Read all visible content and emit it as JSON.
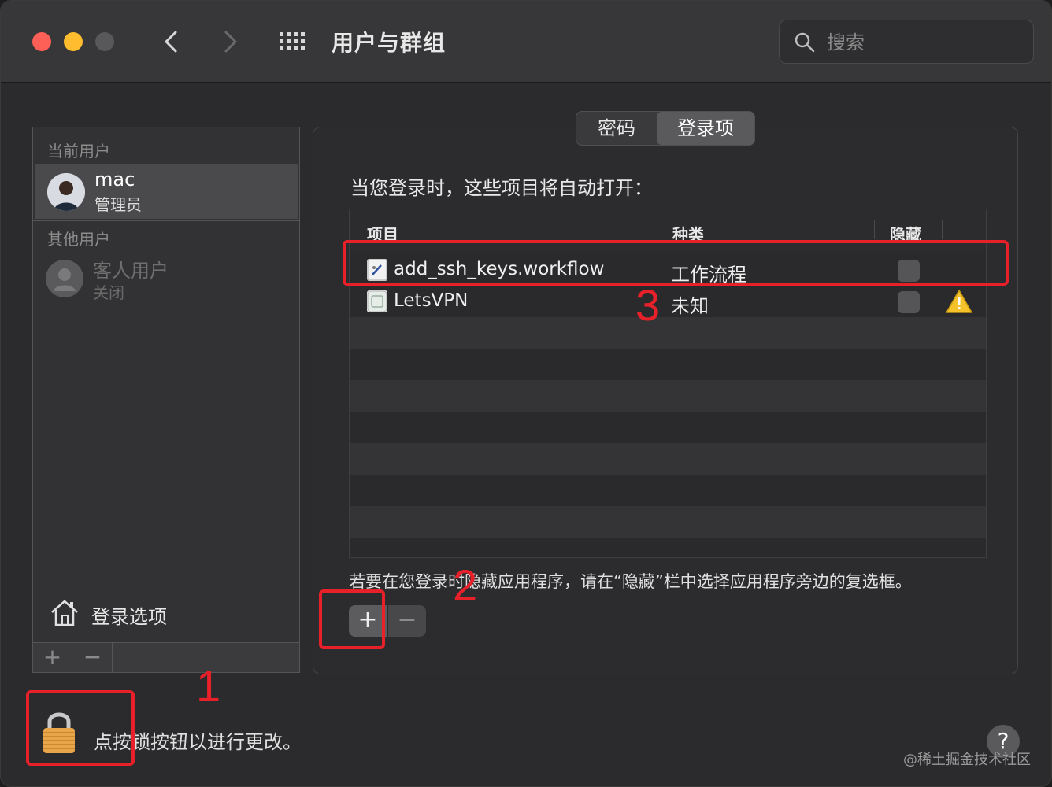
{
  "toolbar": {
    "title": "用户与群组",
    "search_placeholder": "搜索",
    "icons": [
      "back-icon",
      "forward-icon",
      "grid-icon",
      "search-icon"
    ]
  },
  "sidebar": {
    "current_users_header": "当前用户",
    "current_user": {
      "name": "mac",
      "role": "管理员"
    },
    "other_users_header": "其他用户",
    "guest_user": {
      "name": "客人用户",
      "status": "关闭"
    },
    "login_options_label": "登录选项",
    "add_label": "+",
    "remove_label": "−"
  },
  "tabs": [
    {
      "label": "密码",
      "selected": false
    },
    {
      "label": "登录项",
      "selected": true
    }
  ],
  "main": {
    "heading": "当您登录时，这些项目将自动打开：",
    "columns": {
      "item": "项目",
      "kind": "种类",
      "hide": "隐藏"
    },
    "rows": [
      {
        "name": "add_ssh_keys.workflow",
        "kind": "工作流程",
        "hidden": false,
        "warning": false
      },
      {
        "name": "LetsVPN",
        "kind": "未知",
        "hidden": false,
        "warning": true
      }
    ],
    "hint": "若要在您登录时隐藏应用程序，请在“隐藏”栏中选择应用程序旁边的复选框。",
    "add_label": "+",
    "remove_label": "−"
  },
  "footer": {
    "lock_text": "点按锁按钮以进行更改。",
    "help_label": "?",
    "watermark": "@稀土掘金技术社区"
  },
  "annotations": {
    "one": "1",
    "two": "2",
    "three": "3",
    "color": "#e8202a"
  },
  "colors": {
    "window_bg": "#2b2b2d",
    "selection": "#4a4a4c",
    "accent_red": "#fe5f57",
    "accent_yellow": "#febc2e"
  }
}
